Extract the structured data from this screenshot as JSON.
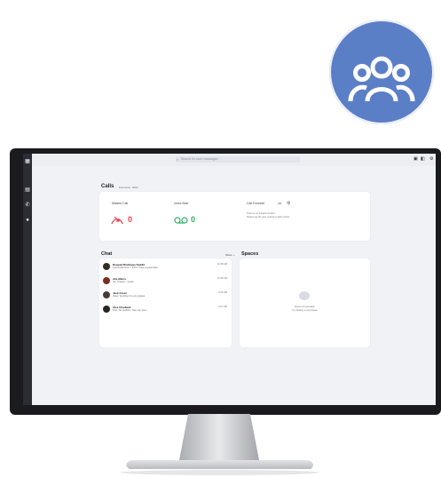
{
  "logo": {
    "icon": "people-group-icon",
    "color": "#5b7fc6"
  },
  "app": {
    "search_placeholder": "Search for user, messages",
    "rail_items": [
      {
        "icon": "apps-icon",
        "label": "Apps"
      },
      {
        "icon": "calendar-icon",
        "label": "Calendar"
      },
      {
        "icon": "phone-icon",
        "label": "Calls"
      },
      {
        "icon": "chat-icon",
        "label": "Chat"
      }
    ],
    "top_right_icons": [
      "screen-share-icon",
      "camera-icon",
      "settings-icon"
    ]
  },
  "calls": {
    "title": "Calls",
    "subtitle": "Extension: 0000",
    "missed_label": "Missed Call",
    "missed_count": "0",
    "voicemail_label": "Voice Mail",
    "voicemail_count": "0",
    "forward_label": "Call Forward",
    "forward_state": "Off",
    "forward_desc1": "There is no forward number.",
    "forward_desc2": "Please tap the gear setting to add number."
  },
  "chat": {
    "title": "Chat",
    "filter": "Show ⌄",
    "items": [
      {
        "name": "Deepak Mindwave Reddit",
        "message": "Good Afternoon. I think I have a great idea",
        "time": "11:08 AM"
      },
      {
        "name": "Alie Marco",
        "message": "Ok, Thanks... Great",
        "time": "11:08 AM"
      },
      {
        "name": "Jack Green",
        "message": "Okay. Sending it to you please",
        "time": "2:53 PM"
      },
      {
        "name": "Alex Chadwell",
        "message": "Fine, No problem. See you soon",
        "time": "2:07 PM"
      }
    ]
  },
  "spaces": {
    "title": "Spaces",
    "empty1": "Start a conversation",
    "empty2": "by creating a new Space"
  }
}
